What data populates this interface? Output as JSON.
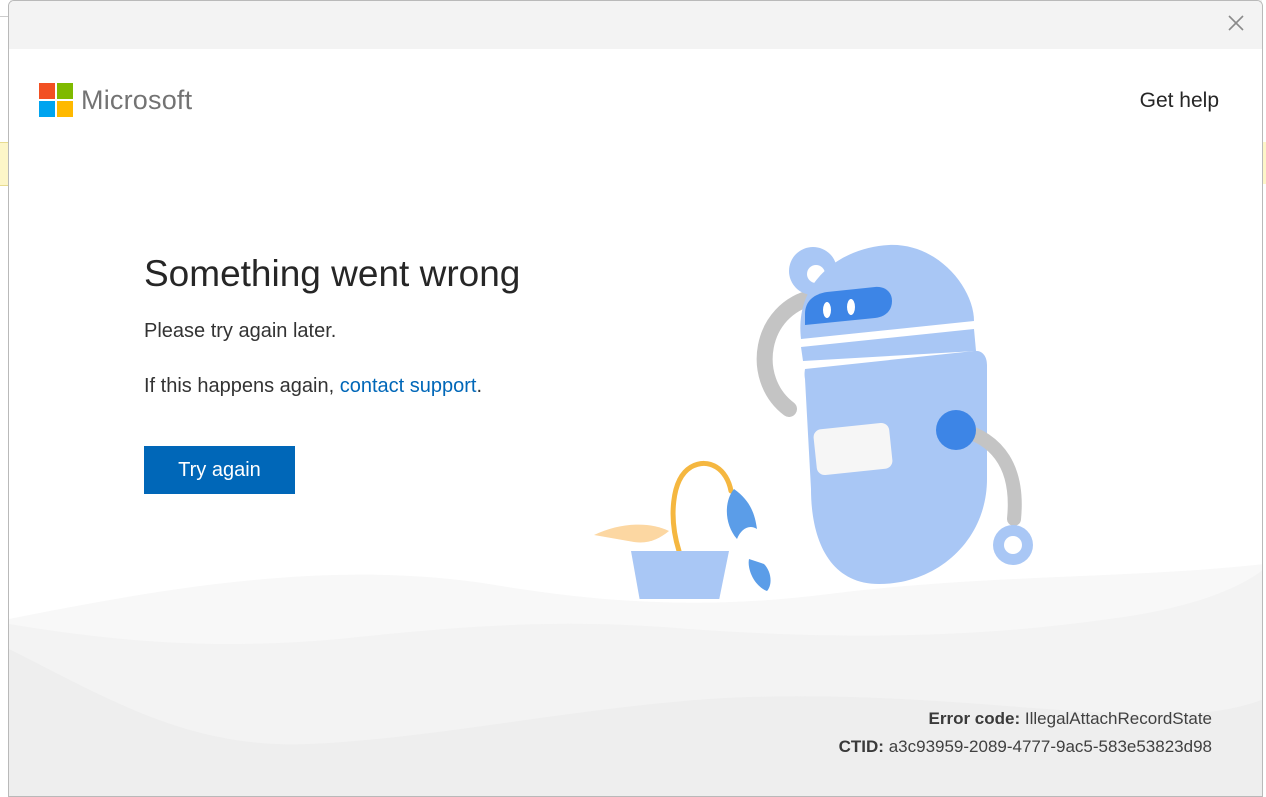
{
  "brand": {
    "name": "Microsoft",
    "logo_colors": [
      "#f25022",
      "#7fba00",
      "#00a4ef",
      "#ffb900"
    ]
  },
  "header": {
    "get_help_label": "Get help"
  },
  "main": {
    "title": "Something went wrong",
    "message": "Please try again later.",
    "support_prefix": "If this happens again, ",
    "support_link": "contact support",
    "support_suffix": ".",
    "try_again_label": "Try again"
  },
  "error": {
    "code_label": "Error code:",
    "code_value": "IllegalAttachRecordState",
    "ctid_label": "CTID:",
    "ctid_value": "a3c93959-2089-4777-9ac5-583e53823d98"
  },
  "icons": {
    "close": "close-icon",
    "illustration": "robot-watering-plant-illustration"
  },
  "colors": {
    "accent": "#0067b8",
    "link": "#0067b8",
    "title_bar": "#f3f3f3",
    "robot_body": "#a9c7f5",
    "robot_dark": "#3d85e6"
  }
}
